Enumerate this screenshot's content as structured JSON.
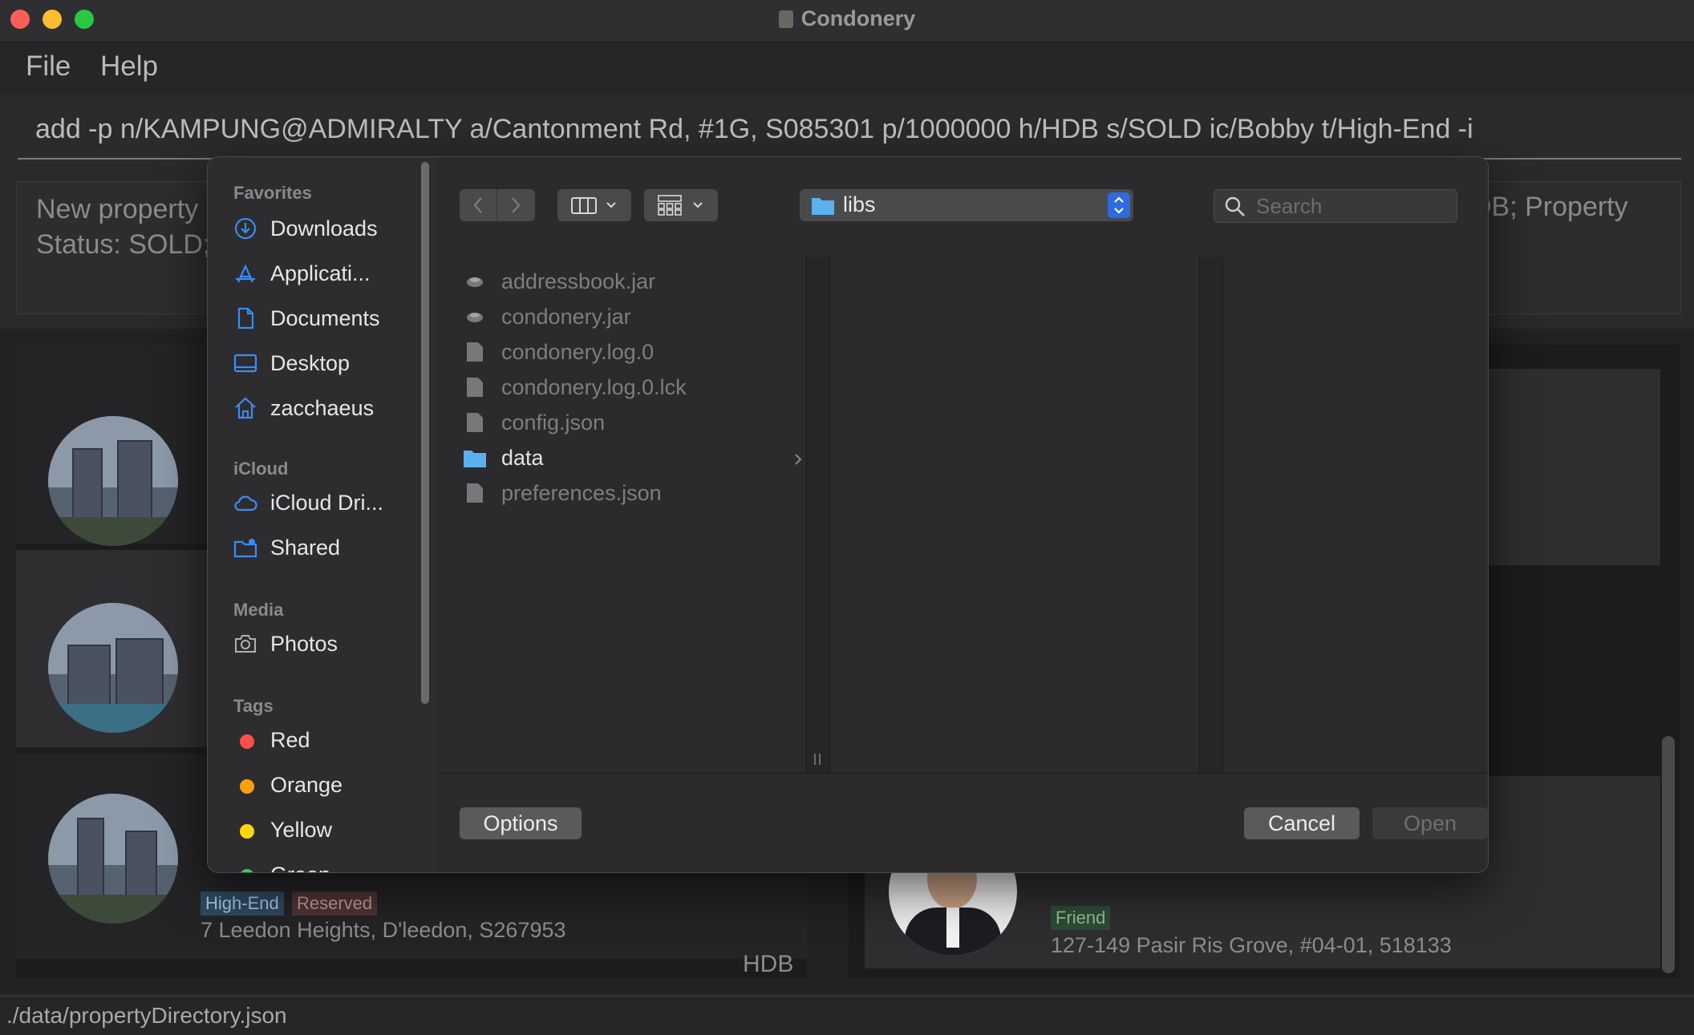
{
  "window": {
    "title": "Condonery",
    "controls": {
      "close_color": "#ff5f57",
      "minimize_color": "#febc2e",
      "zoom_color": "#28c840"
    }
  },
  "menu": {
    "file": "File",
    "help": "Help"
  },
  "command": {
    "text": "add -p n/KAMPUNG@ADMIRALTY a/Cantonment Rd, #1G, S085301 p/1000000 h/HDB s/SOLD ic/Bobby t/High-End  -i"
  },
  "result": {
    "line1_left": "New property a",
    "line1_right": "DB; Property",
    "line2_left": "Status: SOLD; "
  },
  "property_list": {
    "card3": {
      "tags": [
        "High-End",
        "Reserved"
      ],
      "address": "7 Leedon Heights, D'leedon, S267953",
      "type": "HDB"
    }
  },
  "client_list": {
    "card": {
      "tag": "Friend",
      "address": "127-149 Pasir Ris Grove, #04-01, 518133"
    }
  },
  "status_bar": {
    "path": "./data/propertyDirectory.json"
  },
  "dialog": {
    "sidebar": {
      "favorites_header": "Favorites",
      "favorites": [
        {
          "label": "Downloads",
          "icon": "downloads-icon"
        },
        {
          "label": "Applicati...",
          "icon": "applications-icon"
        },
        {
          "label": "Documents",
          "icon": "document-icon"
        },
        {
          "label": "Desktop",
          "icon": "desktop-icon"
        },
        {
          "label": "zacchaeus",
          "icon": "home-icon"
        }
      ],
      "icloud_header": "iCloud",
      "icloud": [
        {
          "label": "iCloud Dri...",
          "icon": "cloud-icon"
        },
        {
          "label": "Shared",
          "icon": "shared-folder-icon"
        }
      ],
      "media_header": "Media",
      "media": [
        {
          "label": "Photos",
          "icon": "camera-icon"
        }
      ],
      "tags_header": "Tags",
      "tags": [
        {
          "label": "Red",
          "color": "#ff4f4a"
        },
        {
          "label": "Orange",
          "color": "#ff9f0a"
        },
        {
          "label": "Yellow",
          "color": "#ffd60a"
        },
        {
          "label": "Green",
          "color": "#30d158"
        }
      ]
    },
    "toolbar": {
      "location": "libs",
      "search_placeholder": "Search"
    },
    "files": [
      {
        "name": "addressbook.jar",
        "kind": "jar"
      },
      {
        "name": "condonery.jar",
        "kind": "jar"
      },
      {
        "name": "condonery.log.0",
        "kind": "file"
      },
      {
        "name": "condonery.log.0.lck",
        "kind": "file"
      },
      {
        "name": "config.json",
        "kind": "file"
      },
      {
        "name": "data",
        "kind": "folder"
      },
      {
        "name": "preferences.json",
        "kind": "file"
      }
    ],
    "buttons": {
      "options": "Options",
      "cancel": "Cancel",
      "open": "Open"
    },
    "accent": "#2f6be0"
  }
}
